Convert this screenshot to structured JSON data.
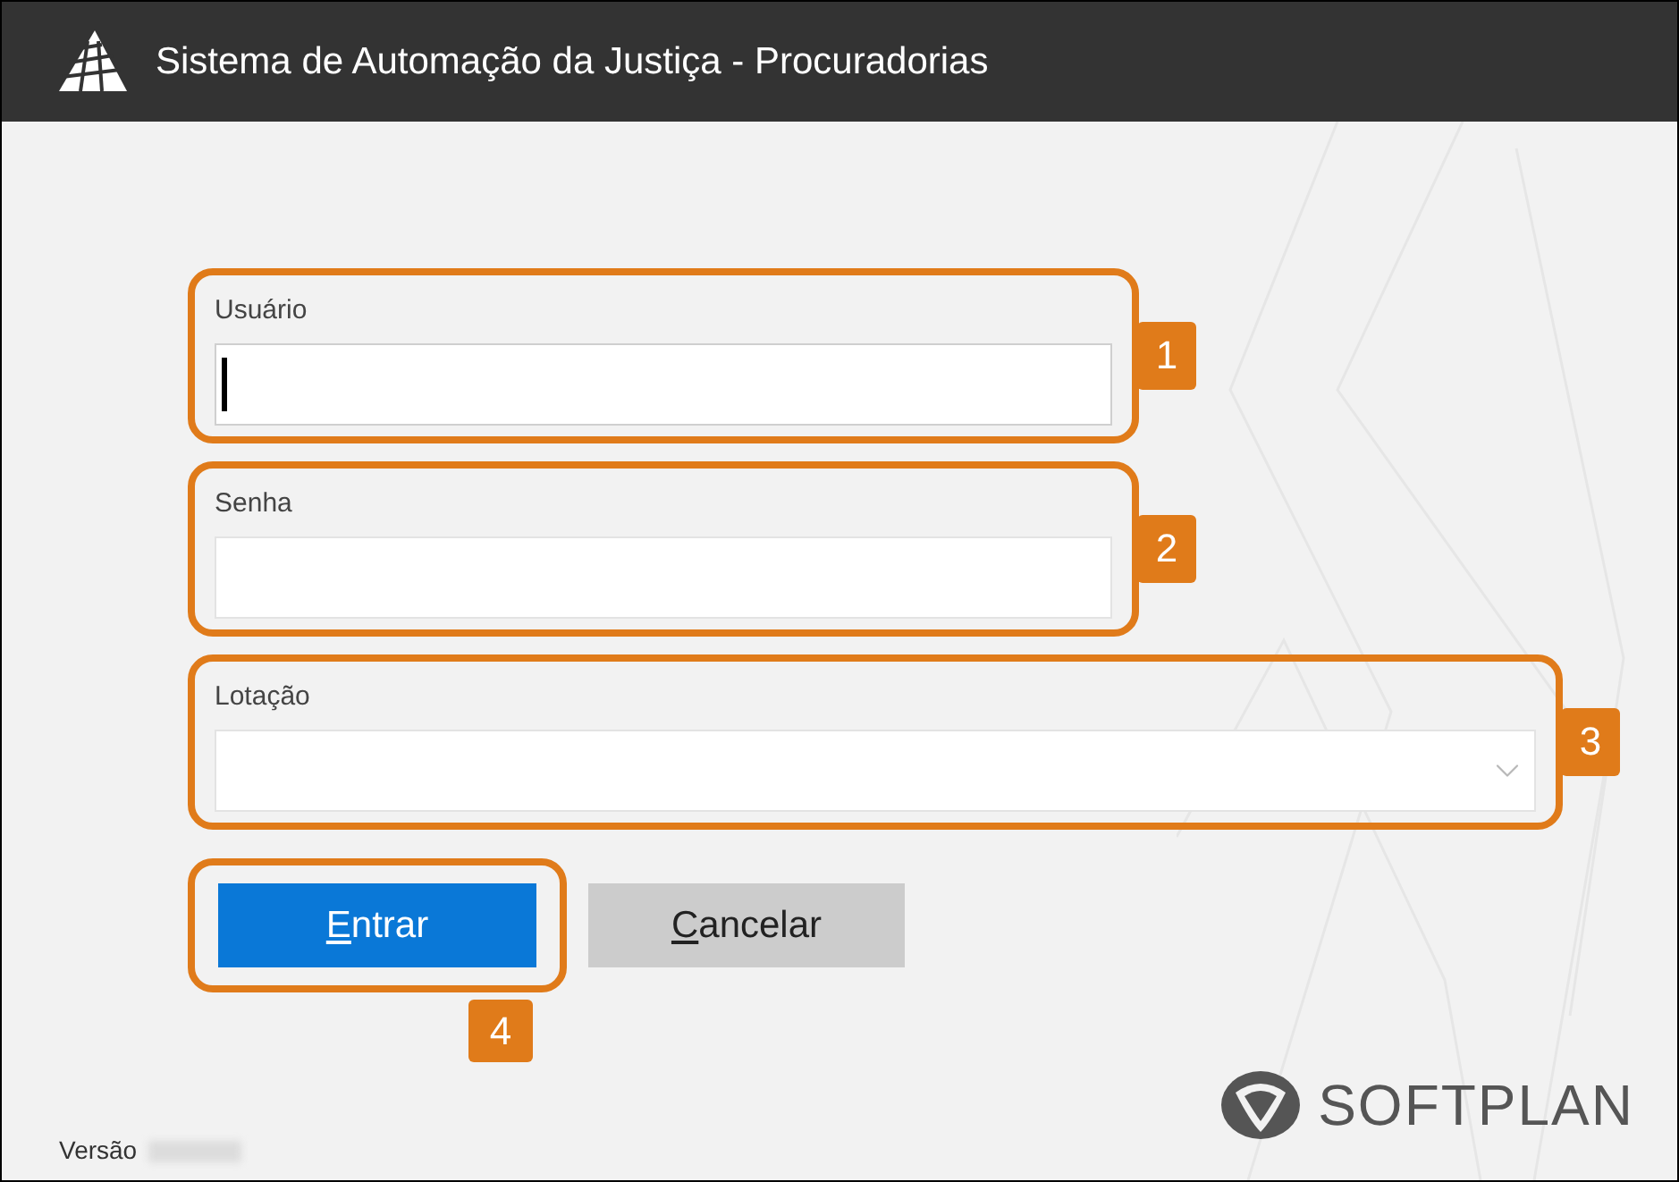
{
  "window": {
    "title": "Sistema de Automação da Justiça - Procuradorias"
  },
  "fields": [
    {
      "label": "Usuário",
      "kind": "text",
      "focused": true,
      "callout": "1"
    },
    {
      "label": "Senha",
      "kind": "password",
      "focused": false,
      "callout": "2"
    },
    {
      "label": "Lotação",
      "kind": "select",
      "focused": false,
      "callout": "3"
    }
  ],
  "buttons": [
    {
      "label": "Entrar",
      "kind": "primary",
      "access_key": true
    },
    {
      "label": "Cancelar",
      "kind": "secondary",
      "access_key": true
    }
  ],
  "buttons_callout": "4",
  "footer": {
    "version_label": "Versão",
    "brand": "SOFTPLAN"
  }
}
